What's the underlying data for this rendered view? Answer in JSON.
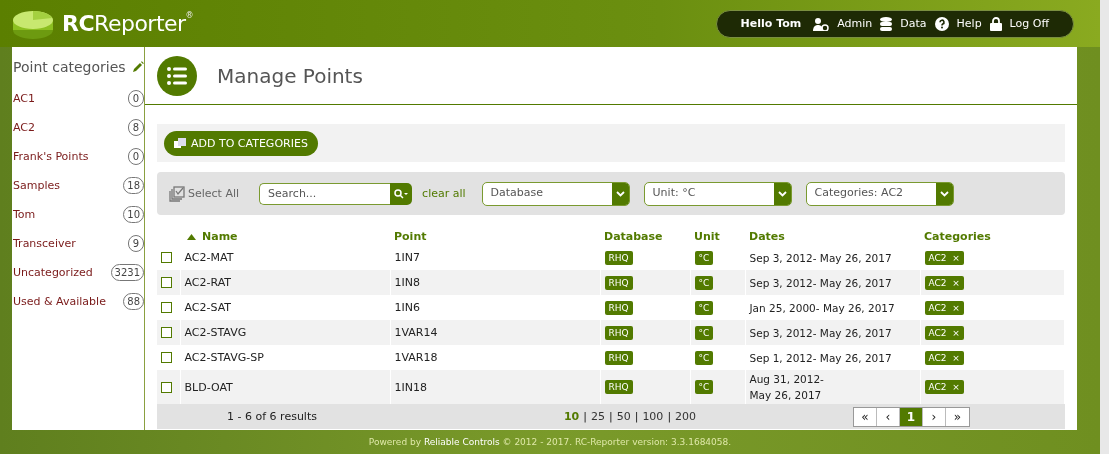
{
  "header": {
    "logo": "RCReporter",
    "logo_mark": "®",
    "greeting": "Hello Tom",
    "nav": [
      {
        "label": "Admin",
        "kind": "admin"
      },
      {
        "label": "Data",
        "kind": "data"
      },
      {
        "label": "Help",
        "kind": "help"
      },
      {
        "label": "Log Off",
        "kind": "logoff"
      }
    ]
  },
  "sidebar": {
    "title": "Point categories",
    "items": [
      {
        "label": "AC1",
        "count": "0"
      },
      {
        "label": "AC2",
        "count": "8"
      },
      {
        "label": "Frank's Points",
        "count": "0"
      },
      {
        "label": "Samples",
        "count": "18"
      },
      {
        "label": "Tom",
        "count": "10"
      },
      {
        "label": "Transceiver",
        "count": "9"
      },
      {
        "label": "Uncategorized",
        "count": "3231"
      },
      {
        "label": "Used & Available",
        "count": "88"
      }
    ]
  },
  "page_title": "Manage Points",
  "toolbar": {
    "button": "ADD TO CATEGORIES"
  },
  "filters": {
    "select_all": "Select All",
    "search_placeholder": "Search...",
    "clear_all": "clear all",
    "dropdowns": [
      "Database",
      "Unit: °C",
      "Categories: AC2"
    ]
  },
  "table": {
    "columns": [
      "Name",
      "Point",
      "Database",
      "Unit",
      "Dates",
      "Categories"
    ],
    "rows": [
      {
        "checked": false,
        "name": "AC2-MAT",
        "point": "1IN7",
        "database": "RHQ",
        "unit": "°C",
        "dates": [
          "Sep 3, 2012- May 26, 2017"
        ],
        "category": "AC2"
      },
      {
        "checked": false,
        "name": "AC2-RAT",
        "point": "1IN8",
        "database": "RHQ",
        "unit": "°C",
        "dates": [
          "Sep 3, 2012- May 26, 2017"
        ],
        "category": "AC2"
      },
      {
        "checked": false,
        "name": "AC2-SAT",
        "point": "1IN6",
        "database": "RHQ",
        "unit": "°C",
        "dates": [
          "Jan 25, 2000- May 26, 2017"
        ],
        "category": "AC2"
      },
      {
        "checked": false,
        "name": "AC2-STAVG",
        "point": "1VAR14",
        "database": "RHQ",
        "unit": "°C",
        "dates": [
          "Sep 3, 2012- May 26, 2017"
        ],
        "category": "AC2"
      },
      {
        "checked": false,
        "name": "AC2-STAVG-SP",
        "point": "1VAR18",
        "database": "RHQ",
        "unit": "°C",
        "dates": [
          "Sep 1, 2012- May 26, 2017"
        ],
        "category": "AC2"
      },
      {
        "checked": false,
        "name": "BLD-OAT",
        "point": "1IN18",
        "database": "RHQ",
        "unit": "°C",
        "dates": [
          "Aug 31, 2012-",
          "May 26, 2017"
        ],
        "category": "AC2"
      }
    ],
    "remove_mark": "×"
  },
  "pagination": {
    "summary": "1 - 6 of 6 results",
    "page_sizes": [
      {
        "label": "10",
        "selected": true
      },
      {
        "label": "25",
        "selected": false
      },
      {
        "label": "50",
        "selected": false
      },
      {
        "label": "100",
        "selected": false
      },
      {
        "label": "200",
        "selected": false
      }
    ],
    "separator": "|",
    "pages": [
      {
        "label": "«",
        "selected": false
      },
      {
        "label": "‹",
        "selected": false
      },
      {
        "label": "1",
        "selected": true
      },
      {
        "label": "›",
        "selected": false
      },
      {
        "label": "»",
        "selected": false
      }
    ]
  },
  "footer": {
    "prefix": "Powered by",
    "company": "Reliable Controls",
    "suffix": "© 2012 - 2017. RC-Reporter version: 3.3.1684058."
  }
}
